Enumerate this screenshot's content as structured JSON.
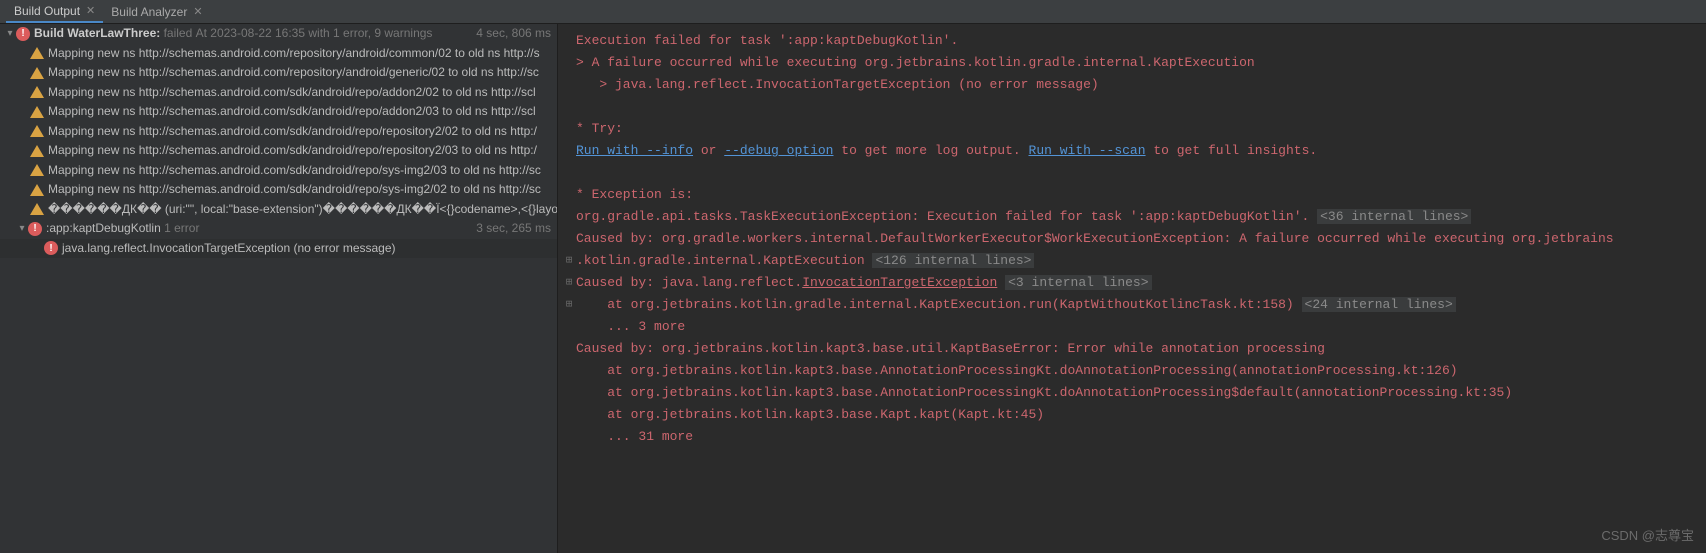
{
  "tabs": [
    {
      "label": "Build Output",
      "active": true
    },
    {
      "label": "Build Analyzer",
      "active": false
    }
  ],
  "tree": {
    "root": {
      "title_bold": "Build WaterLawThree:",
      "status": "failed",
      "meta": "At 2023-08-22 16:35 with 1 error, 9 warnings",
      "time": "4 sec, 806 ms"
    },
    "warnings": [
      "Mapping new ns http://schemas.android.com/repository/android/common/02 to old ns http://s",
      "Mapping new ns http://schemas.android.com/repository/android/generic/02 to old ns http://sc",
      "Mapping new ns http://schemas.android.com/sdk/android/repo/addon2/02 to old ns http://scl",
      "Mapping new ns http://schemas.android.com/sdk/android/repo/addon2/03 to old ns http://scl",
      "Mapping new ns http://schemas.android.com/sdk/android/repo/repository2/02 to old ns http:/",
      "Mapping new ns http://schemas.android.com/sdk/android/repo/repository2/03 to old ns http:/",
      "Mapping new ns http://schemas.android.com/sdk/android/repo/sys-img2/03 to old ns http://sc",
      "Mapping new ns http://schemas.android.com/sdk/android/repo/sys-img2/02 to old ns http://sc",
      "������ДК�� (uri:\"\", local:\"base-extension\")������ДК��Ï<{}codename>,<{}layoutlib>"
    ],
    "task": {
      "name": ":app:kaptDebugKotlin",
      "meta": "1 error",
      "time": "3 sec, 265 ms"
    },
    "error": {
      "msg": "java.lang.reflect.InvocationTargetException (no error message)"
    }
  },
  "console": {
    "l1": "Execution failed for task ':app:kaptDebugKotlin'.",
    "l2": "> A failure occurred while executing org.jetbrains.kotlin.gradle.internal.KaptExecution",
    "l3": "   > java.lang.reflect.InvocationTargetException (no error message)",
    "l4": "* Try:",
    "l5a": "Run with --info",
    "l5b": " or ",
    "l5c": "--debug option",
    "l5d": " to get more log output. ",
    "l5e": "Run with --scan",
    "l5f": " to get full insights.",
    "l6": "* Exception is:",
    "l7a": "org.gradle.api.tasks.TaskExecutionException: Execution failed for task ':app:kaptDebugKotlin'. ",
    "l7b": "<36 internal lines>",
    "l8": "Caused by: org.gradle.workers.internal.DefaultWorkerExecutor$WorkExecutionException: A failure occurred while executing org.jetbrains",
    "l9a": ".kotlin.gradle.internal.KaptExecution ",
    "l9b": "<126 internal lines>",
    "l10a": "Caused by: java.lang.reflect.",
    "l10b": "InvocationTargetException",
    "l10c": " ",
    "l10d": "<3 internal lines>",
    "l11a": "    at org.jetbrains.kotlin.gradle.internal.KaptExecution.run(KaptWithoutKotlincTask.kt:158) ",
    "l11b": "<24 internal lines>",
    "l12": "    ... 3 more",
    "l13": "Caused by: org.jetbrains.kotlin.kapt3.base.util.KaptBaseError: Error while annotation processing",
    "l14": "    at org.jetbrains.kotlin.kapt3.base.AnnotationProcessingKt.doAnnotationProcessing(annotationProcessing.kt:126)",
    "l15": "    at org.jetbrains.kotlin.kapt3.base.AnnotationProcessingKt.doAnnotationProcessing$default(annotationProcessing.kt:35)",
    "l16": "    at org.jetbrains.kotlin.kapt3.base.Kapt.kapt(Kapt.kt:45)",
    "l17": "    ... 31 more"
  },
  "watermark": "CSDN @志尊宝"
}
